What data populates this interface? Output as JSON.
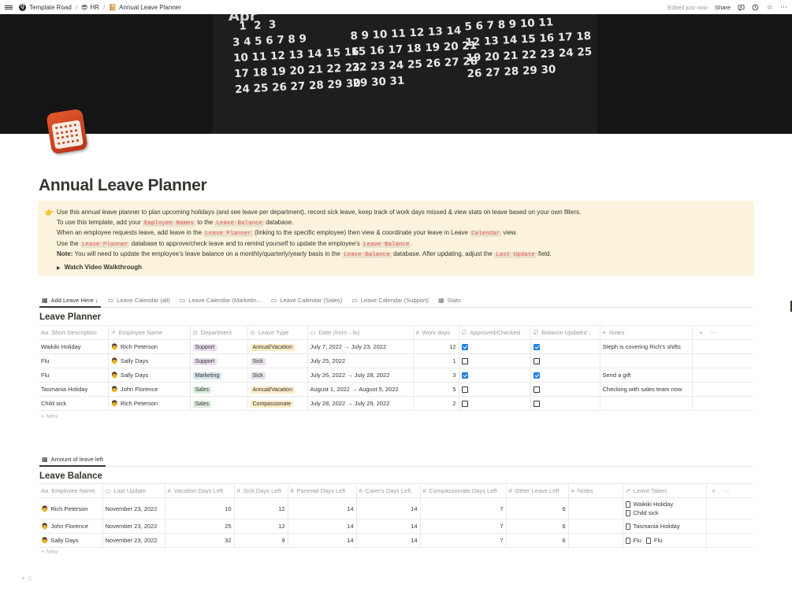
{
  "breadcrumb": [
    {
      "icon": "Q",
      "label": "Template Road"
    },
    {
      "icon": "😎",
      "label": "HR"
    },
    {
      "icon": "📔",
      "label": "Annual Leave Planner"
    }
  ],
  "topbar": {
    "edited": "Edited just now",
    "share": "Share"
  },
  "cover": {
    "month": "Apr",
    "block1": "  1  2  3\n3 4 5 6 7 8 9\n10 11 12 13 14 15 16\n17 18 19 20 21 22 23\n24 25 26 27 28 29 30",
    "block2": "8 9 10 11 12 13 14\n15 16 17 18 19 20 21\n22 23 24 25 26 27 28\n29 30 31",
    "block3": "5 6 7 8 9 10 11\n12 13 14 15 16 17 18\n19 20 21 22 23 24 25\n26 27 28 29 30"
  },
  "page": {
    "title": "Annual Leave Planner"
  },
  "callout": {
    "emoji": "👉",
    "line1": "Use this annual leave planner to plan upcoming holidays (and see leave per department), record sick leave, keep track of work days missed & view stats on leave based on your own filters.",
    "line2_a": "To use this template, add your",
    "line2_code1": "Employee Names",
    "line2_b": "to the",
    "line2_code2": "Leave Balance",
    "line2_c": "database.",
    "line3_a": "When an employee requests leave, add leave in the",
    "line3_code1": "Leave Planner",
    "line3_b": "(linking to the specific employee) then view & coordinate your leave in Leave",
    "line3_code2": "Calendar",
    "line3_c": "view.",
    "line4_a": "Use the",
    "line4_code1": "Leave Planner",
    "line4_b": "database to approve/check leave and to remind yourself to update the employee's",
    "line4_code2": "Leave Balance",
    "line4_c": ".",
    "line5_bold": "Note:",
    "line5_a": "You will need to update the employee's leave balance on a monthly/quarterly/yearly basis in the",
    "line5_code1": "Leave Balance",
    "line5_b": "database. After updating, adjust the",
    "line5_code2": "Last Update",
    "line5_c": "field.",
    "toggle": "Watch Video Walkthrough"
  },
  "tabs": [
    {
      "label": "Add Leave Here ↓",
      "icon": "▦",
      "active": true
    },
    {
      "label": "Leave Calendar (all)",
      "icon": "▭"
    },
    {
      "label": "Leave Calendar (Marketin...",
      "icon": "▭"
    },
    {
      "label": "Leave Calendar (Sales)",
      "icon": "▭"
    },
    {
      "label": "Leave Calendar (Support)",
      "icon": "▭"
    },
    {
      "label": "Stats",
      "icon": "▦"
    }
  ],
  "planner": {
    "title": "Leave Planner",
    "columns": [
      {
        "icon": "Aa",
        "label": "Short Description"
      },
      {
        "icon": "↗",
        "label": "Employee Name"
      },
      {
        "icon": "⊙",
        "label": "Department"
      },
      {
        "icon": "⊙",
        "label": "Leave Type"
      },
      {
        "icon": "▭",
        "label": "Date (from→to)"
      },
      {
        "icon": "#",
        "label": "Work days"
      },
      {
        "icon": "☑",
        "label": "Approved/Checked"
      },
      {
        "icon": "☑",
        "label": "Balance Updated ↓"
      },
      {
        "icon": "≡",
        "label": "Notes"
      }
    ],
    "rows": [
      {
        "desc": "Waikiki Holiday",
        "emp": "Rich Peterson",
        "dept": "Support",
        "type": "Annual/Vacation",
        "date": "July 7, 2022 → July 23, 2022",
        "days": "12",
        "approved": true,
        "balance": true,
        "notes": "Steph is covering Rich's shifts"
      },
      {
        "desc": "Flu",
        "emp": "Sally Days",
        "dept": "Support",
        "type": "Sick",
        "date": "July 25, 2022",
        "days": "1",
        "approved": false,
        "balance": false,
        "notes": ""
      },
      {
        "desc": "Flu",
        "emp": "Sally Days",
        "dept": "Marketing",
        "type": "Sick",
        "date": "July 26, 2022 → July 28, 2022",
        "days": "3",
        "approved": true,
        "balance": true,
        "notes": "Send a gift"
      },
      {
        "desc": "Tasmania Holiday",
        "emp": "John Florence",
        "dept": "Sales",
        "type": "Annual/Vacation",
        "date": "August 1, 2022 → August 5, 2022",
        "days": "5",
        "approved": false,
        "balance": false,
        "notes": "Checking with sales team now"
      },
      {
        "desc": "Child sick",
        "emp": "Rich Peterson",
        "dept": "Sales",
        "type": "Compassionate",
        "date": "July 28, 2022 → July 29, 2022",
        "days": "2",
        "approved": false,
        "balance": false,
        "notes": ""
      }
    ],
    "new_label": "+ New"
  },
  "balance_tab": {
    "label": "Amount of leave left",
    "icon": "▦"
  },
  "balance": {
    "title": "Leave Balance",
    "columns": [
      {
        "icon": "Aa",
        "label": "Employee Name"
      },
      {
        "icon": "▭",
        "label": "Last Update"
      },
      {
        "icon": "#",
        "label": "Vacation Days Left"
      },
      {
        "icon": "#",
        "label": "Sick Days Left"
      },
      {
        "icon": "#",
        "label": "Parental Days Left"
      },
      {
        "icon": "#",
        "label": "Carer's Days Left"
      },
      {
        "icon": "#",
        "label": "Compassionate Days Left"
      },
      {
        "icon": "#",
        "label": "Other Leave Left"
      },
      {
        "icon": "≡",
        "label": "Notes"
      },
      {
        "icon": "↗",
        "label": "Leave Taken"
      }
    ],
    "rows": [
      {
        "emp": "Rich Peterson",
        "update": "November 23, 2022",
        "vac": "10",
        "sick": "12",
        "par": "14",
        "carer": "14",
        "comp": "7",
        "other": "6",
        "notes": "",
        "taken": [
          "Waikiki Holiday",
          "Child sick"
        ]
      },
      {
        "emp": "John Florence",
        "update": "November 23, 2022",
        "vac": "25",
        "sick": "12",
        "par": "14",
        "carer": "14",
        "comp": "7",
        "other": "6",
        "notes": "",
        "taken": [
          "Tasmania Holiday"
        ]
      },
      {
        "emp": "Sally Days",
        "update": "November 23, 2022",
        "vac": "32",
        "sick": "9",
        "par": "14",
        "carer": "14",
        "comp": "7",
        "other": "6",
        "notes": "",
        "taken": [
          "Flu",
          "Flu"
        ]
      }
    ],
    "new_label": "+ New"
  }
}
